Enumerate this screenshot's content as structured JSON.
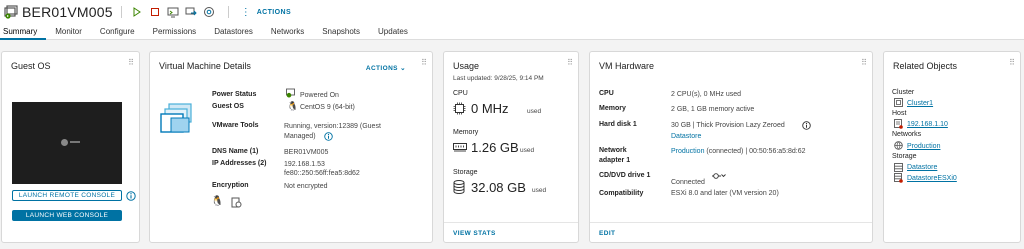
{
  "header": {
    "vm_name": "BER01VM005",
    "actions_label": "ACTIONS"
  },
  "tabs": [
    {
      "label": "Summary",
      "active": true
    },
    {
      "label": "Monitor"
    },
    {
      "label": "Configure"
    },
    {
      "label": "Permissions"
    },
    {
      "label": "Datastores"
    },
    {
      "label": "Networks"
    },
    {
      "label": "Snapshots"
    },
    {
      "label": "Updates"
    }
  ],
  "guest_os": {
    "title": "Guest OS",
    "launch_remote": "LAUNCH REMOTE CONSOLE",
    "launch_web": "LAUNCH WEB CONSOLE"
  },
  "vm_details": {
    "title": "Virtual Machine Details",
    "actions_label": "ACTIONS",
    "rows": {
      "power_status": {
        "label": "Power Status",
        "value": "Powered On"
      },
      "guest_os": {
        "label": "Guest OS",
        "value": "CentOS 9 (64-bit)"
      },
      "vmware_tools": {
        "label": "VMware Tools",
        "value_line1": "Running, version:12389 (Guest",
        "value_line2": "Managed)"
      },
      "dns_name": {
        "label": "DNS Name (1)",
        "value": "BER01VM005"
      },
      "ip_addresses": {
        "label": "IP Addresses (2)",
        "value_line1": "192.168.1.53",
        "value_line2": "fe80::250:56ff:fea5:8d62"
      },
      "encryption": {
        "label": "Encryption",
        "value": "Not encrypted"
      }
    }
  },
  "usage": {
    "title": "Usage",
    "last_updated": "Last updated: 9/28/25, 9:14 PM",
    "cpu_label": "CPU",
    "cpu_value": "0 MHz",
    "cpu_unit": "used",
    "memory_label": "Memory",
    "memory_value": "1.26 GB",
    "memory_unit": "used",
    "storage_label": "Storage",
    "storage_value": "32.08 GB",
    "storage_unit": "used",
    "view_stats": "VIEW STATS"
  },
  "vm_hardware": {
    "title": "VM Hardware",
    "rows": {
      "cpu": {
        "label": "CPU",
        "value": "2 CPU(s), 0 MHz used"
      },
      "memory": {
        "label": "Memory",
        "value": "2 GB, 1 GB memory active"
      },
      "hard_disk": {
        "label": "Hard disk 1",
        "value": "30 GB | Thick Provision Lazy Zeroed",
        "link": "Datastore"
      },
      "network": {
        "label_line1": "Network",
        "label_line2": "adapter 1",
        "link": "Production",
        "value": "(connected) | 00:50:56:a5:8d:62"
      },
      "cd_dvd": {
        "label": "CD/DVD drive 1",
        "value": "Connected"
      },
      "compatibility": {
        "label": "Compatibility",
        "value": "ESXi 8.0 and later (VM version 20)"
      }
    },
    "edit": "EDIT"
  },
  "related_objects": {
    "title": "Related Objects",
    "cluster_label": "Cluster",
    "cluster": "Cluster1",
    "host_label": "Host",
    "host": "192.168.1.10",
    "networks_label": "Networks",
    "network": "Production",
    "storage_label": "Storage",
    "storage": [
      "Datastore",
      "DatastoreESXi0"
    ]
  },
  "colors": {
    "accent": "#0072a3",
    "web_console_btn": "#0072a3",
    "power_on": "#3c8500"
  }
}
